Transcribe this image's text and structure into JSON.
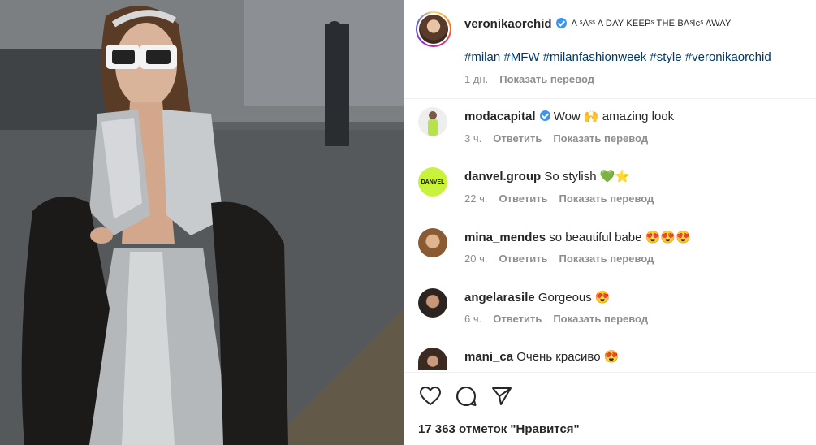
{
  "post": {
    "author": "veronikaorchid",
    "caption": "A ˢAˢˢ A DAY KEEPˢ THE BAˢIcˢ AWAY",
    "hashtags": "#milan #MFW #milanfashionweek #style #veronikaorchid",
    "time": "1 дн.",
    "translate": "Показать перевод"
  },
  "comments": [
    {
      "user": "modacapital",
      "verified": true,
      "text": "Wow 🙌 amazing look",
      "time": "3 ч.",
      "reply": "Ответить",
      "translate": "Показать перевод"
    },
    {
      "user": "danvel.group",
      "verified": false,
      "text": "So stylish 💚⭐",
      "time": "22 ч.",
      "reply": "Ответить",
      "translate": "Показать перевод",
      "avatar_text": "DANVEL"
    },
    {
      "user": "mina_mendes",
      "verified": false,
      "text": "so beautiful babe 😍😍😍",
      "time": "20 ч.",
      "reply": "Ответить",
      "translate": "Показать перевод"
    },
    {
      "user": "angelarasile",
      "verified": false,
      "text": "Gorgeous 😍",
      "time": "6 ч.",
      "reply": "Ответить",
      "translate": "Показать перевод"
    },
    {
      "user": "mani_ca",
      "verified": false,
      "text": "Очень красиво 😍"
    }
  ],
  "actions": {
    "like_icon": "heart-icon",
    "comment_icon": "comment-icon",
    "share_icon": "share-icon"
  },
  "likes": "17 363 отметок \"Нравится\"",
  "colors": {
    "link": "#00376b",
    "meta": "#8e8e8e",
    "verified": "#3897f0",
    "danvel_avatar": "#c8f23c"
  }
}
